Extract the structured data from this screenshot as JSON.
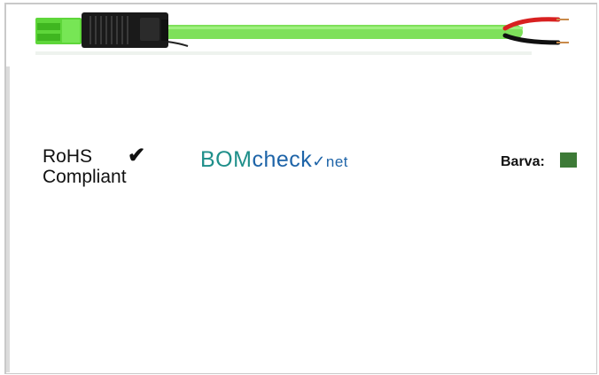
{
  "certification": {
    "line1": "RoHS",
    "line2": "Compliant",
    "check_glyph": "✔"
  },
  "bomcheck": {
    "part1": "BOM",
    "part2": "check",
    "part3": "net"
  },
  "color": {
    "label": "Barva:",
    "swatch_hex": "#3d7a37"
  },
  "product_image": {
    "cable_color": "#7ee05a",
    "connector_color": "#1a1a1a",
    "wire_colors": [
      "#d82020",
      "#101010"
    ]
  }
}
